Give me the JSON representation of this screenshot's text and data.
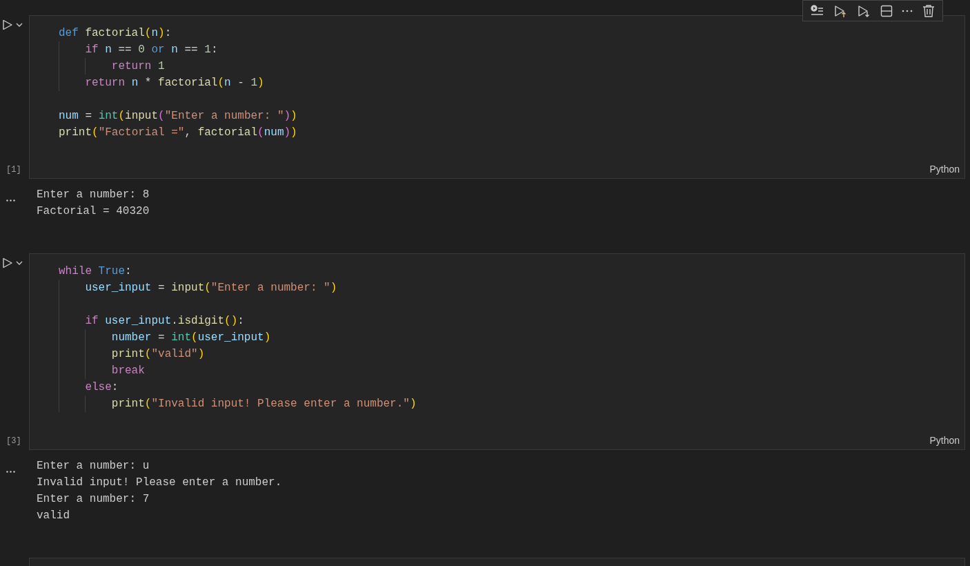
{
  "cells": [
    {
      "kind": "code",
      "focused": true,
      "execution_count": "[1]",
      "language": "Python",
      "code": [
        {
          "kind": "code",
          "tokens": [
            {
              "text": "def ",
              "kind": "kw"
            },
            {
              "text": "factorial",
              "kind": "fn"
            },
            {
              "text": "(",
              "kind": "br1"
            },
            {
              "text": "n",
              "kind": "var"
            },
            {
              "text": ")",
              "kind": "br1"
            },
            {
              "text": ":",
              "kind": "op"
            }
          ],
          "children": [
            {
              "kind": "code",
              "tokens": [
                {
                  "text": "if ",
                  "kind": "ctrl"
                },
                {
                  "text": "n",
                  "kind": "var"
                },
                {
                  "text": " == ",
                  "kind": "op"
                },
                {
                  "text": "0",
                  "kind": "num"
                },
                {
                  "text": " or ",
                  "kind": "kw"
                },
                {
                  "text": "n",
                  "kind": "var"
                },
                {
                  "text": " == ",
                  "kind": "op"
                },
                {
                  "text": "1",
                  "kind": "num"
                },
                {
                  "text": ":",
                  "kind": "op"
                }
              ],
              "children": [
                {
                  "kind": "code",
                  "tokens": [
                    {
                      "text": "return ",
                      "kind": "ctrl"
                    },
                    {
                      "text": "1",
                      "kind": "num"
                    }
                  ]
                }
              ]
            },
            {
              "kind": "code",
              "tokens": [
                {
                  "text": "return ",
                  "kind": "ctrl"
                },
                {
                  "text": "n",
                  "kind": "var"
                },
                {
                  "text": " * ",
                  "kind": "op"
                },
                {
                  "text": "factorial",
                  "kind": "fn"
                },
                {
                  "text": "(",
                  "kind": "br1"
                },
                {
                  "text": "n",
                  "kind": "var"
                },
                {
                  "text": " - ",
                  "kind": "op"
                },
                {
                  "text": "1",
                  "kind": "num"
                },
                {
                  "text": ")",
                  "kind": "br1"
                }
              ]
            }
          ]
        },
        {
          "kind": "blank"
        },
        {
          "kind": "code",
          "tokens": [
            {
              "text": "num",
              "kind": "var"
            },
            {
              "text": " = ",
              "kind": "op"
            },
            {
              "text": "int",
              "kind": "cls"
            },
            {
              "text": "(",
              "kind": "br1"
            },
            {
              "text": "input",
              "kind": "fn"
            },
            {
              "text": "(",
              "kind": "br2"
            },
            {
              "text": "\"Enter a number: \"",
              "kind": "str"
            },
            {
              "text": ")",
              "kind": "br2"
            },
            {
              "text": ")",
              "kind": "br1"
            }
          ]
        },
        {
          "kind": "code",
          "tokens": [
            {
              "text": "print",
              "kind": "fn"
            },
            {
              "text": "(",
              "kind": "br1"
            },
            {
              "text": "\"Factorial =\"",
              "kind": "str"
            },
            {
              "text": ", ",
              "kind": "op"
            },
            {
              "text": "factorial",
              "kind": "fn"
            },
            {
              "text": "(",
              "kind": "br2"
            },
            {
              "text": "num",
              "kind": "var"
            },
            {
              "text": ")",
              "kind": "br2"
            },
            {
              "text": ")",
              "kind": "br1"
            }
          ]
        }
      ],
      "output": [
        "Enter a number: 8",
        "Factorial = 40320"
      ]
    },
    {
      "kind": "code",
      "focused": false,
      "execution_count": "[3]",
      "language": "Python",
      "code": [
        {
          "kind": "code",
          "tokens": [
            {
              "text": "while ",
              "kind": "ctrl"
            },
            {
              "text": "True",
              "kind": "kw"
            },
            {
              "text": ":",
              "kind": "op"
            }
          ],
          "children": [
            {
              "kind": "code",
              "tokens": [
                {
                  "text": "user_input",
                  "kind": "var"
                },
                {
                  "text": " = ",
                  "kind": "op"
                },
                {
                  "text": "input",
                  "kind": "fn"
                },
                {
                  "text": "(",
                  "kind": "br1"
                },
                {
                  "text": "\"Enter a number: \"",
                  "kind": "str"
                },
                {
                  "text": ")",
                  "kind": "br1"
                }
              ]
            },
            {
              "kind": "blank"
            },
            {
              "kind": "code",
              "tokens": [
                {
                  "text": "if ",
                  "kind": "ctrl"
                },
                {
                  "text": "user_input",
                  "kind": "var"
                },
                {
                  "text": ".",
                  "kind": "op"
                },
                {
                  "text": "isdigit",
                  "kind": "fn"
                },
                {
                  "text": "()",
                  "kind": "br1"
                },
                {
                  "text": ":",
                  "kind": "op"
                }
              ],
              "children": [
                {
                  "kind": "code",
                  "tokens": [
                    {
                      "text": "number",
                      "kind": "var"
                    },
                    {
                      "text": " = ",
                      "kind": "op"
                    },
                    {
                      "text": "int",
                      "kind": "cls"
                    },
                    {
                      "text": "(",
                      "kind": "br1"
                    },
                    {
                      "text": "user_input",
                      "kind": "var"
                    },
                    {
                      "text": ")",
                      "kind": "br1"
                    }
                  ]
                },
                {
                  "kind": "code",
                  "tokens": [
                    {
                      "text": "print",
                      "kind": "fn"
                    },
                    {
                      "text": "(",
                      "kind": "br1"
                    },
                    {
                      "text": "\"valid\"",
                      "kind": "str"
                    },
                    {
                      "text": ")",
                      "kind": "br1"
                    }
                  ]
                },
                {
                  "kind": "code",
                  "tokens": [
                    {
                      "text": "break",
                      "kind": "ctrl"
                    }
                  ]
                }
              ]
            },
            {
              "kind": "code",
              "tokens": [
                {
                  "text": "else",
                  "kind": "ctrl"
                },
                {
                  "text": ":",
                  "kind": "op"
                }
              ],
              "children": [
                {
                  "kind": "code",
                  "tokens": [
                    {
                      "text": "print",
                      "kind": "fn"
                    },
                    {
                      "text": "(",
                      "kind": "br1"
                    },
                    {
                      "text": "\"Invalid input! Please enter a number.\"",
                      "kind": "str"
                    },
                    {
                      "text": ")",
                      "kind": "br1"
                    }
                  ]
                }
              ]
            }
          ]
        }
      ],
      "output": [
        "Enter a number: u",
        "Invalid input! Please enter a number.",
        "Enter a number: 7",
        "valid"
      ]
    },
    {
      "kind": "empty",
      "focused": false
    }
  ]
}
